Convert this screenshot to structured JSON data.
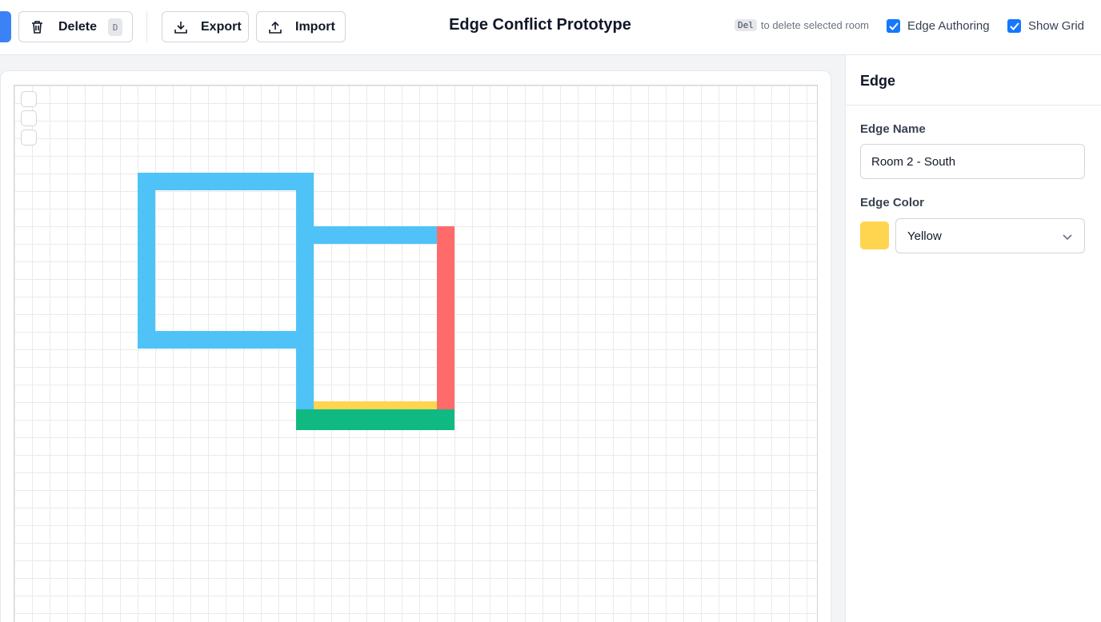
{
  "toolbar": {
    "delete_label": "Delete",
    "delete_shortcut": "D",
    "export_label": "Export",
    "import_label": "Import",
    "title": "Edge Conflict Prototype",
    "hint_key": "Del",
    "hint_text": "to delete selected room",
    "edge_authoring_label": "Edge Authoring",
    "edge_authoring_checked": true,
    "show_grid_label": "Show Grid",
    "show_grid_checked": true
  },
  "panel": {
    "heading": "Edge",
    "edge_name_label": "Edge Name",
    "edge_name_value": "Room 2 - South",
    "edge_color_label": "Edge Color",
    "edge_color_value": "Yellow",
    "edge_color_hex": "#ffd54f"
  },
  "colors": {
    "accent": "#1677ff",
    "room_edge_blue": "#4fc3f7",
    "edge_red": "#ff6b6b",
    "edge_green": "#10b981",
    "edge_yellow": "#ffd54f"
  },
  "icons": {
    "delete": "trash-icon",
    "export": "download-icon",
    "import": "upload-icon",
    "select": "chevron-down-icon"
  }
}
